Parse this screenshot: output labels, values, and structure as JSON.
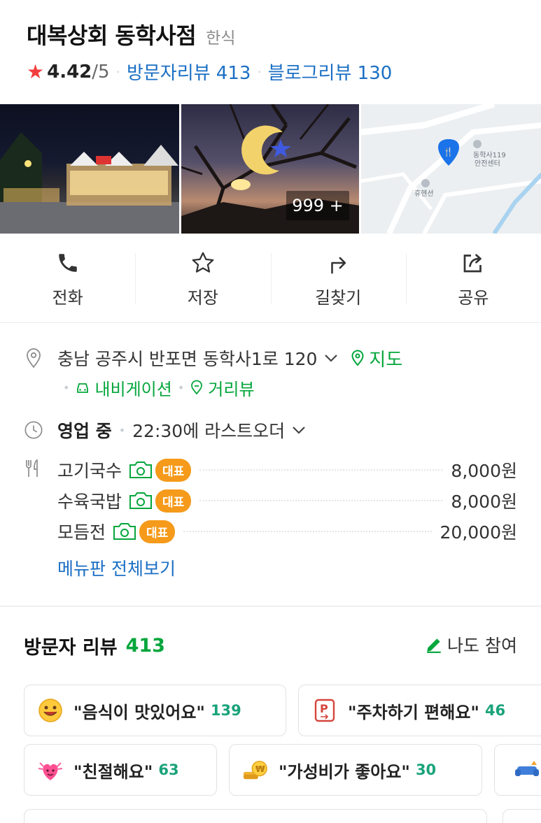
{
  "place": {
    "name": "대복상회 동학사점",
    "category": "한식",
    "rating": "4.42",
    "rating_max": "/5",
    "visitor_reviews": "방문자리뷰 413",
    "blog_reviews": "블로그리뷰 130"
  },
  "photos": {
    "more_count": "999 +",
    "map_labels": [
      "동학사119",
      "안전센터",
      "휴헨션"
    ]
  },
  "actions": [
    {
      "label": "전화",
      "icon": "phone-icon"
    },
    {
      "label": "저장",
      "icon": "star-outline-icon"
    },
    {
      "label": "길찾기",
      "icon": "directions-icon"
    },
    {
      "label": "공유",
      "icon": "share-icon"
    }
  ],
  "info": {
    "address": "충남 공주시 반포면 동학사1로 120",
    "map_link": "지도",
    "navigation_link": "내비게이션",
    "street_view_link": "거리뷰",
    "status": "영업 중",
    "last_order": "22:30에 라스트오더",
    "menu": [
      {
        "name": "고기국수",
        "badge": "대표",
        "price": "8,000원"
      },
      {
        "name": "수육국밥",
        "badge": "대표",
        "price": "8,000원"
      },
      {
        "name": "모듬전",
        "badge": "대표",
        "price": "20,000원"
      }
    ],
    "menu_all": "메뉴판 전체보기"
  },
  "reviews": {
    "title": "방문자 리뷰",
    "count": "413",
    "write": "나도 참여",
    "keywords": [
      {
        "text": "\"음식이 맛있어요\"",
        "count": "139",
        "icon": "smile-emoji-icon"
      },
      {
        "text": "\"주차하기 편해요\"",
        "count": "46",
        "icon": "parking-icon"
      },
      {
        "text": "\"친절해요\"",
        "count": "63",
        "icon": "heart-emoji-icon"
      },
      {
        "text": "\"가성비가 좋아요\"",
        "count": "30",
        "icon": "coin-icon"
      }
    ]
  },
  "colors": {
    "link_blue": "#1b6fc4",
    "green": "#05a63c",
    "badge_orange": "#f59a1a",
    "star_red": "#f33e3e",
    "count_teal": "#1aa37a"
  }
}
